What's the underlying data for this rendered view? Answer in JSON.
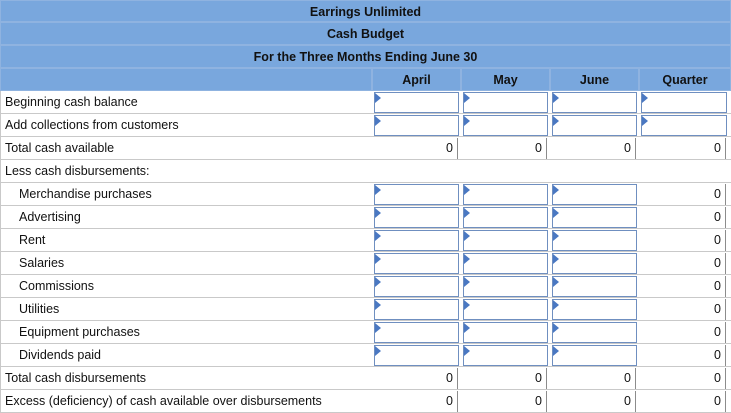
{
  "header": {
    "company": "Earrings Unlimited",
    "report": "Cash Budget",
    "period": "For the Three Months Ending June 30"
  },
  "columns": [
    "April",
    "May",
    "June",
    "Quarter"
  ],
  "rows": [
    {
      "label": "Beginning cash balance",
      "indent": false,
      "cells": [
        "",
        "",
        "",
        ""
      ],
      "inputs": [
        true,
        true,
        true,
        true
      ]
    },
    {
      "label": "Add collections from customers",
      "indent": false,
      "cells": [
        "",
        "",
        "",
        ""
      ],
      "inputs": [
        true,
        true,
        true,
        true
      ]
    },
    {
      "label": "Total cash available",
      "indent": false,
      "cells": [
        "0",
        "0",
        "0",
        "0"
      ],
      "inputs": [
        false,
        false,
        false,
        false
      ]
    },
    {
      "label": "Less cash disbursements:",
      "indent": false,
      "cells": [
        "",
        "",
        "",
        ""
      ],
      "inputs": [
        false,
        false,
        false,
        false
      ]
    },
    {
      "label": "Merchandise purchases",
      "indent": true,
      "cells": [
        "",
        "",
        "",
        "0"
      ],
      "inputs": [
        true,
        true,
        true,
        false
      ]
    },
    {
      "label": "Advertising",
      "indent": true,
      "cells": [
        "",
        "",
        "",
        "0"
      ],
      "inputs": [
        true,
        true,
        true,
        false
      ]
    },
    {
      "label": "Rent",
      "indent": true,
      "cells": [
        "",
        "",
        "",
        "0"
      ],
      "inputs": [
        true,
        true,
        true,
        false
      ]
    },
    {
      "label": "Salaries",
      "indent": true,
      "cells": [
        "",
        "",
        "",
        "0"
      ],
      "inputs": [
        true,
        true,
        true,
        false
      ]
    },
    {
      "label": "Commissions",
      "indent": true,
      "cells": [
        "",
        "",
        "",
        "0"
      ],
      "inputs": [
        true,
        true,
        true,
        false
      ]
    },
    {
      "label": "Utilities",
      "indent": true,
      "cells": [
        "",
        "",
        "",
        "0"
      ],
      "inputs": [
        true,
        true,
        true,
        false
      ]
    },
    {
      "label": "Equipment purchases",
      "indent": true,
      "cells": [
        "",
        "",
        "",
        "0"
      ],
      "inputs": [
        true,
        true,
        true,
        false
      ]
    },
    {
      "label": "Dividends paid",
      "indent": true,
      "cells": [
        "",
        "",
        "",
        "0"
      ],
      "inputs": [
        true,
        true,
        true,
        false
      ]
    },
    {
      "label": "Total cash disbursements",
      "indent": false,
      "cells": [
        "0",
        "0",
        "0",
        "0"
      ],
      "inputs": [
        false,
        false,
        false,
        false
      ]
    },
    {
      "label": "Excess (deficiency) of cash available over disbursements",
      "indent": false,
      "cells": [
        "0",
        "0",
        "0",
        "0"
      ],
      "inputs": [
        false,
        false,
        false,
        false
      ]
    }
  ]
}
